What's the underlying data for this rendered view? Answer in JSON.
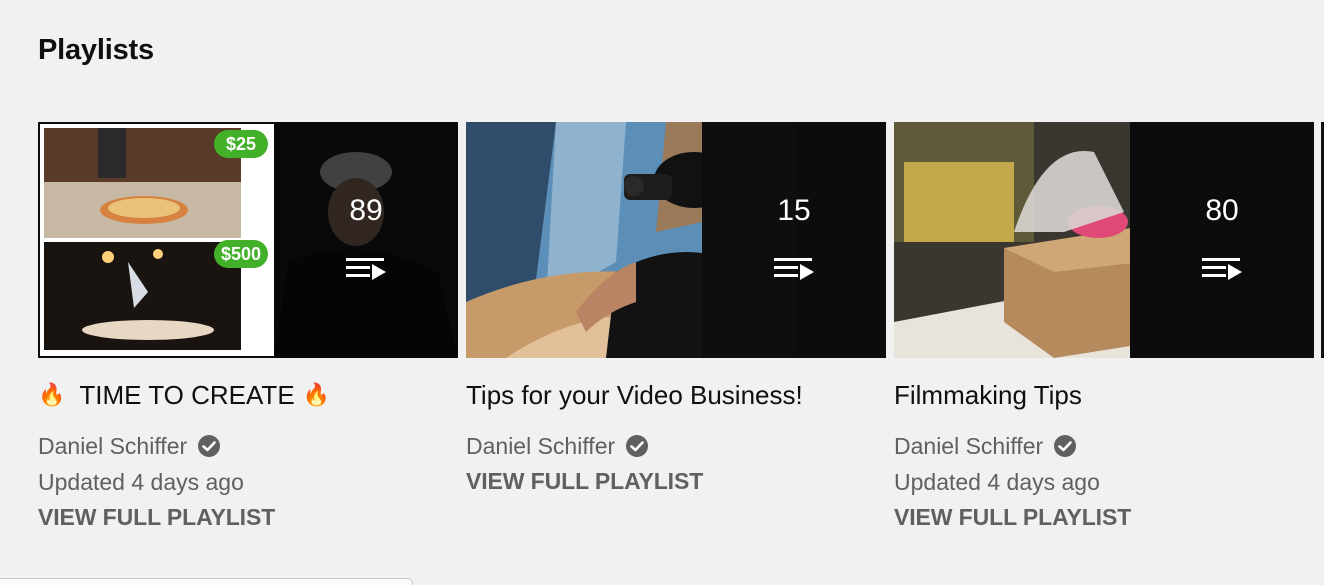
{
  "section": {
    "title": "Playlists"
  },
  "playlists": [
    {
      "title_prefix_emoji": "🔥",
      "title": "TIME TO CREATE",
      "title_suffix_emoji": "🔥",
      "video_count": "89",
      "channel": "Daniel Schiffer",
      "updated": "Updated 4 days ago",
      "action": "VIEW FULL PLAYLIST",
      "thumb_badges": [
        "$25",
        "$500"
      ]
    },
    {
      "title": "Tips for your Video Business!",
      "video_count": "15",
      "channel": "Daniel Schiffer",
      "action": "VIEW FULL PLAYLIST"
    },
    {
      "title": "Filmmaking Tips",
      "video_count": "80",
      "channel": "Daniel Schiffer",
      "updated": "Updated 4 days ago",
      "action": "VIEW FULL PLAYLIST"
    }
  ],
  "icons": {
    "playlist": "playlist-play-icon",
    "verified": "verified-check-icon"
  },
  "colors": {
    "background": "#f1f1f1",
    "meta_text": "#606060",
    "badge_green": "#43b02a"
  }
}
